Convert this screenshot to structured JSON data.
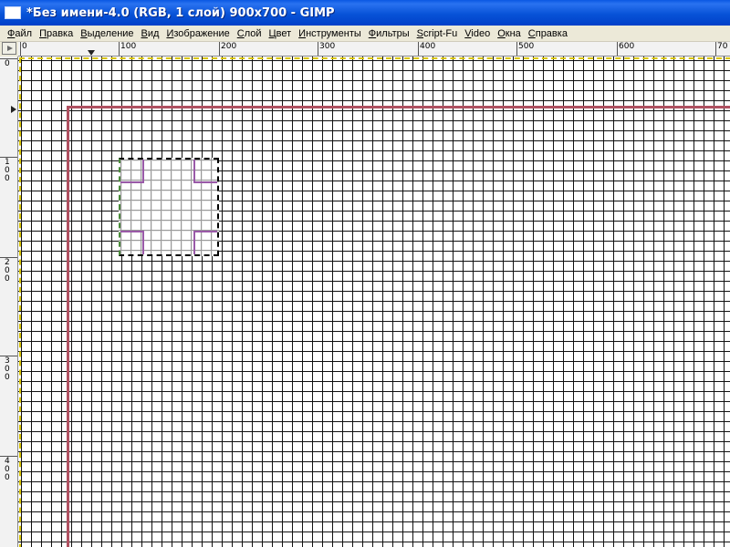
{
  "window": {
    "title": "*Без имени-4.0 (RGB, 1 слой) 900x700 - GIMP",
    "icon": "image-window-icon"
  },
  "menu": [
    {
      "id": "file",
      "label": "Файл"
    },
    {
      "id": "edit",
      "label": "Правка"
    },
    {
      "id": "select",
      "label": "Выделение"
    },
    {
      "id": "view",
      "label": "Вид"
    },
    {
      "id": "image",
      "label": "Изображение"
    },
    {
      "id": "layer",
      "label": "Слой"
    },
    {
      "id": "colors",
      "label": "Цвет"
    },
    {
      "id": "tools",
      "label": "Инструменты"
    },
    {
      "id": "filters",
      "label": "Фильтры"
    },
    {
      "id": "script-fu",
      "label": "Script-Fu"
    },
    {
      "id": "video",
      "label": "Video"
    },
    {
      "id": "windows",
      "label": "Окна"
    },
    {
      "id": "help",
      "label": "Справка"
    }
  ],
  "rulers": {
    "horizontal_labels": [
      "0",
      "100",
      "200",
      "300",
      "400",
      "500",
      "600",
      "70"
    ],
    "vertical_labels": [
      "0",
      "100",
      "200",
      "300",
      "400"
    ]
  },
  "colors": {
    "titlebar": "#0853d8",
    "guide": "#b05060",
    "image_boundary": "#d8c400",
    "selection_handle": "#9a5aa8",
    "grid": "#111111"
  },
  "selection": {
    "tool": "rectangle-select",
    "active": true
  }
}
